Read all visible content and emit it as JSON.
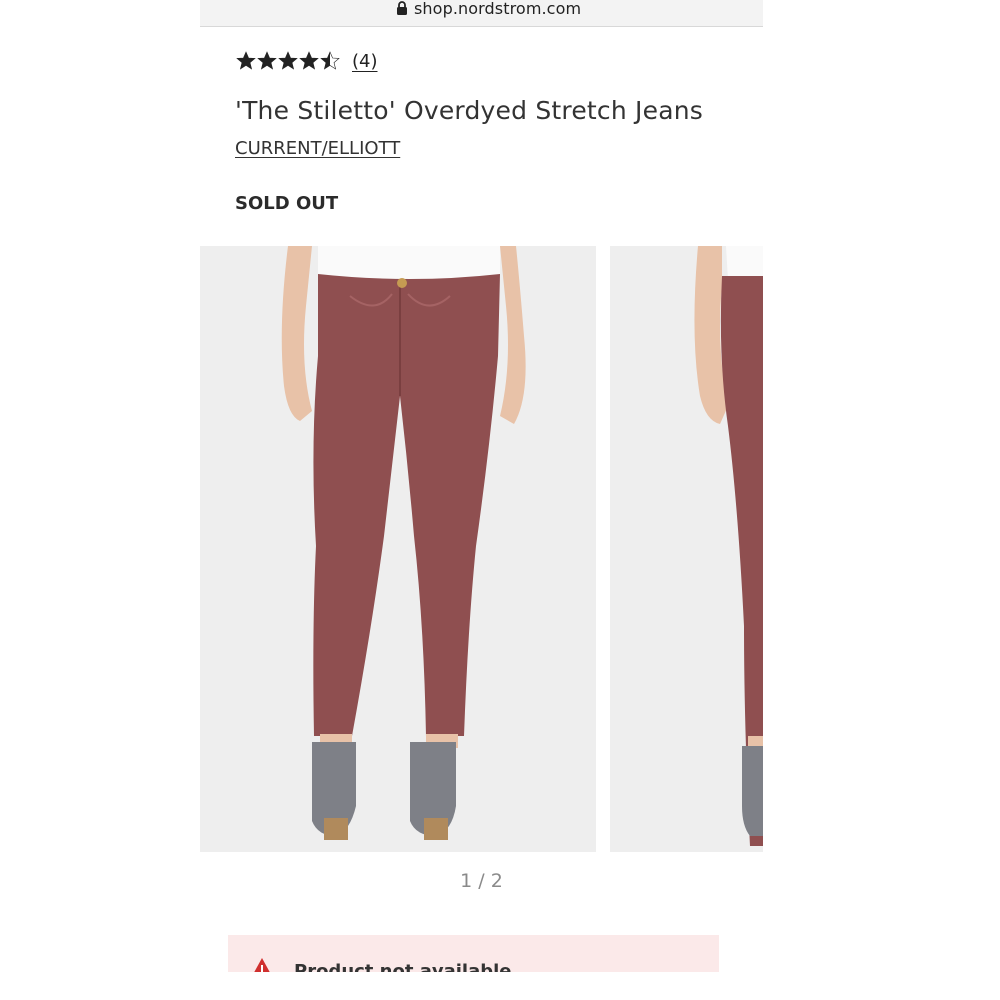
{
  "browser": {
    "url": "shop.nordstrom.com"
  },
  "product": {
    "rating_value": 4.5,
    "rating_max": 5,
    "review_count": "(4)",
    "title": "'The Stiletto' Overdyed Stretch Jeans",
    "brand": "CURRENT/ELLIOTT",
    "availability": "SOLD OUT"
  },
  "gallery": {
    "pager": "1 / 2",
    "current": 1,
    "total": 2,
    "product_color": "#8f4f50"
  },
  "alert": {
    "message": "Product not available",
    "icon": "warning-icon",
    "color": "#d0302f",
    "background": "#fbe9e9"
  }
}
